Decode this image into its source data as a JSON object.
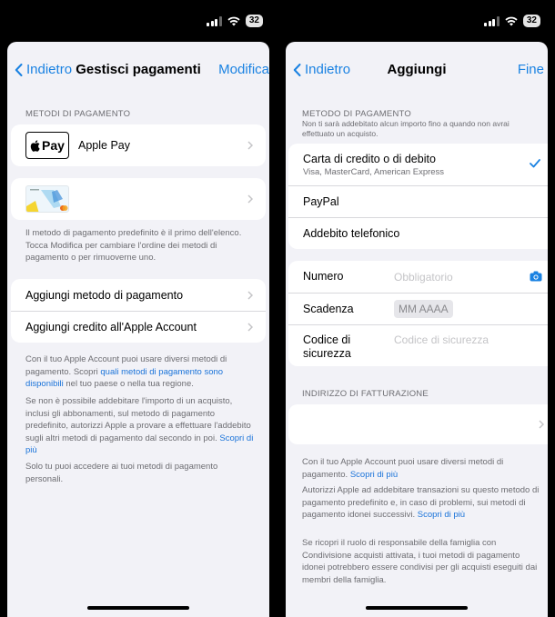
{
  "status": {
    "battery": "32"
  },
  "left": {
    "nav": {
      "back": "Indietro",
      "title": "Gestisci pagamenti",
      "action": "Modifica"
    },
    "section_header": "METODI DI PAGAMENTO",
    "applepay_logo": "Pay",
    "applepay_label": "Apple Pay",
    "order_note": "Il metodo di pagamento predefinito è il primo dell'elenco. Tocca Modifica per cambiare l'ordine dei metodi di pagamento o per rimuoverne uno.",
    "add_method": "Aggiungi metodo di pagamento",
    "add_credit": "Aggiungi credito all'Apple Account",
    "note1_pre": "Con il tuo Apple Account puoi usare diversi metodi di pagamento. Scopri ",
    "note1_link": "quali metodi di pagamento sono disponibili",
    "note1_post": " nel tuo paese o nella tua regione.",
    "note2_pre": "Se non è possibile addebitare l'importo di un acquisto, inclusi gli abbonamenti, sul metodo di pagamento predefinito, autorizzi Apple a provare a effettuare l'addebito sugli altri metodi di pagamento dal secondo in poi. ",
    "note2_link": "Scopri di più",
    "note3": "Solo tu puoi accedere ai tuoi metodi di pagamento personali."
  },
  "right": {
    "nav": {
      "back": "Indietro",
      "title": "Aggiungi",
      "action": "Fine"
    },
    "section_header": "METODO DI PAGAMENTO",
    "section_note": "Non ti sarà addebitato alcun importo fino a quando non avrai effettuato un acquisto.",
    "methods": [
      {
        "label": "Carta di credito o di debito",
        "sub": "Visa, MasterCard, American Express",
        "selected": true
      },
      {
        "label": "PayPal"
      },
      {
        "label": "Addebito telefonico"
      }
    ],
    "fields": {
      "number_label": "Numero",
      "number_placeholder": "Obbligatorio",
      "expiry_label": "Scadenza",
      "expiry_placeholder": "MM AAAA",
      "cvv_label": "Codice di sicurezza",
      "cvv_placeholder": "Codice di sicurezza"
    },
    "billing_header": "INDIRIZZO DI FATTURAZIONE",
    "note1_pre": "Con il tuo Apple Account puoi usare diversi metodi di pagamento. ",
    "note1_link": "Scopri di più",
    "note2_pre": "Autorizzi Apple ad addebitare transazioni su questo metodo di pagamento predefinito e, in caso di problemi, sui metodi di pagamento idonei successivi. ",
    "note2_link": "Scopri di più",
    "note3": "Se ricopri il ruolo di responsabile della famiglia con Condivisione acquisti attivata, i tuoi metodi di pagamento idonei potrebbero essere condivisi per gli acquisti eseguiti dai membri della famiglia."
  },
  "colors": {
    "accent": "#1a82e2",
    "background": "#f2f2f7"
  },
  "icons": [
    "wifi-icon",
    "signal-icon",
    "battery-icon",
    "chevron-left-icon",
    "chevron-right-icon",
    "camera-icon",
    "checkmark-icon",
    "apple-logo-icon"
  ]
}
